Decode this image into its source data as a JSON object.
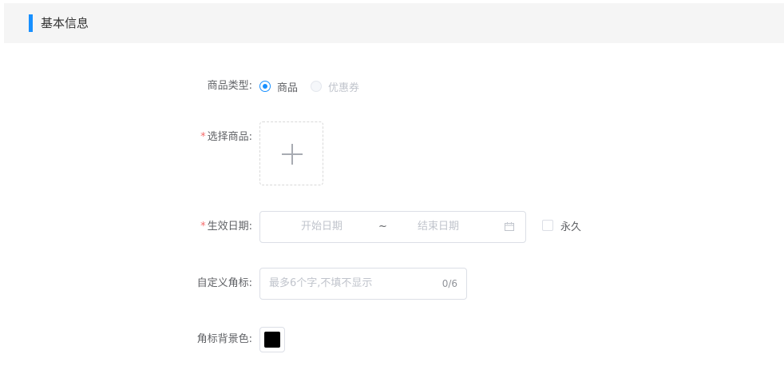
{
  "section": {
    "title": "基本信息",
    "accent_color": "#1890ff"
  },
  "form": {
    "product_type": {
      "label": "商品类型:",
      "options": [
        {
          "label": "商品",
          "checked": true,
          "disabled": false
        },
        {
          "label": "优惠券",
          "checked": false,
          "disabled": true
        }
      ]
    },
    "select_product": {
      "required_mark": "*",
      "label": "选择商品:",
      "upload_icon": "plus-icon"
    },
    "effective_date": {
      "required_mark": "*",
      "label": "生效日期:",
      "start_placeholder": "开始日期",
      "separator": "~",
      "end_placeholder": "结束日期",
      "suffix_icon": "calendar-icon",
      "permanent_label": "永久",
      "permanent_checked": false
    },
    "custom_badge": {
      "label": "自定义角标:",
      "placeholder": "最多6个字,不填不显示",
      "counter": "0/6"
    },
    "badge_bg_color": {
      "label": "角标背景色:",
      "value": "#000000"
    }
  }
}
